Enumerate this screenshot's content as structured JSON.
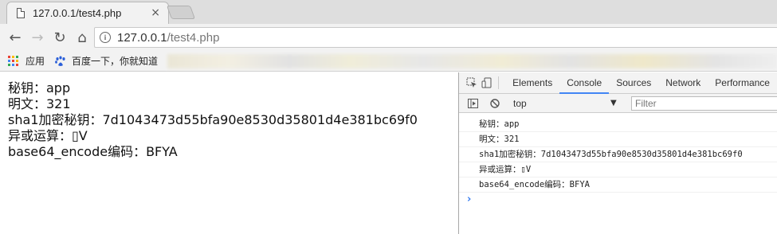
{
  "tab": {
    "title": "127.0.0.1/test4.php",
    "close": "×"
  },
  "toolbar": {
    "back": "←",
    "forward": "→",
    "reload": "↻",
    "home": "⌂",
    "info": "i",
    "url_host": "127.0.0.1",
    "url_path": "/test4.php"
  },
  "bookmarks": {
    "apps_label": "应用",
    "baidu_label": "百度一下，你就知道"
  },
  "page": {
    "lines": [
      "秘钥：app",
      "明文：321",
      "sha1加密秘钥：7d1043473d55bfa90e8530d35801d4e381bc69f0",
      "异或运算：▯V",
      "base64_encode编码：BFYA"
    ]
  },
  "devtools": {
    "tabs": [
      "Elements",
      "Console",
      "Sources",
      "Network",
      "Performance"
    ],
    "active_tab": "Console",
    "context": "top",
    "filter_placeholder": "Filter",
    "console_lines": [
      "秘钥：app",
      "明文：321",
      "sha1加密秘钥：7d1043473d55bfa90e8530d35801d4e381bc69f0",
      "异或运算：▯V",
      "base64_encode编码：BFYA"
    ],
    "prompt": "›"
  },
  "colors": {
    "accent": "#4285f4",
    "prompt": "#367cf1"
  }
}
